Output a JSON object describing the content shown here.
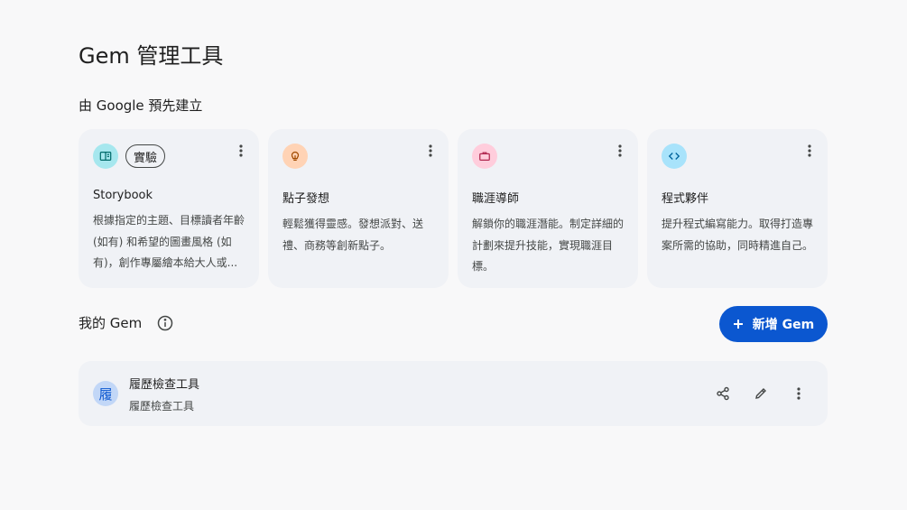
{
  "page": {
    "title": "Gem 管理工具"
  },
  "premade": {
    "heading": "由 Google 預先建立",
    "cards": [
      {
        "name": "Storybook",
        "badge": "實驗",
        "icon": "book-icon",
        "icon_bg": "#a6e7ee",
        "icon_color": "#006a6a",
        "desc": "根據指定的主題、目標讀者年齡 (如有) 和希望的圖畫風格 (如有)，創作專屬繪本給大人或..."
      },
      {
        "name": "點子發想",
        "badge": "",
        "icon": "lightbulb-icon",
        "icon_bg": "#ffd3b5",
        "icon_color": "#a14a00",
        "desc": "輕鬆獲得靈感。發想派對、送禮、商務等創新點子。"
      },
      {
        "name": "職涯導師",
        "badge": "",
        "icon": "briefcase-icon",
        "icon_bg": "#ffcddc",
        "icon_color": "#b0274f",
        "desc": "解鎖你的職涯潛能。制定詳細的計劃來提升技能，實現職涯目標。"
      },
      {
        "name": "程式夥伴",
        "badge": "",
        "icon": "code-icon",
        "icon_bg": "#a8e3fb",
        "icon_color": "#00639b",
        "desc": "提升程式編寫能力。取得打造專案所需的協助，同時精進自己。"
      }
    ]
  },
  "my_gems": {
    "heading": "我的 Gem",
    "new_button": "新增 Gem",
    "items": [
      {
        "avatar": "履",
        "name": "履歷檢查工具",
        "subtitle": "履歷檢查工具"
      }
    ]
  },
  "colors": {
    "accent": "#0b57d0",
    "card_bg": "#f0f2f6",
    "page_bg": "#f8f8f9"
  }
}
